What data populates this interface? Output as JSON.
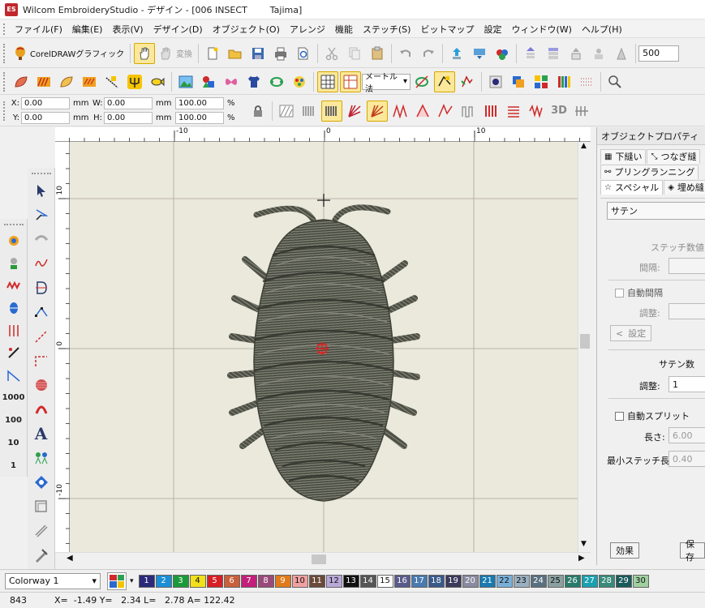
{
  "window": {
    "app_icon_text": "ES",
    "title": "Wilcom EmbroideryStudio - デザイン - [006 INSECT        Tajima]"
  },
  "menu": [
    "ファイル(F)",
    "編集(E)",
    "表示(V)",
    "デザイン(D)",
    "オブジェクト(O)",
    "アレンジ",
    "機能",
    "ステッチ(S)",
    "ビットマップ",
    "設定",
    "ウィンドウ(W)",
    "ヘルプ(H)"
  ],
  "toolbar1": {
    "coreldraw_label": "CorelDRAWグラフィック",
    "convert_label": "変換",
    "zoom_value": "500"
  },
  "toolbar2": {
    "unit_select": "メートル法"
  },
  "coords": {
    "x_label": "X:",
    "x_value": "0.00",
    "x_unit": "mm",
    "y_label": "Y:",
    "y_value": "0.00",
    "y_unit": "mm",
    "w_label": "W:",
    "w_value": "0.00",
    "w_unit": "mm",
    "h_label": "H:",
    "h_value": "0.00",
    "h_unit": "mm",
    "w_pct": "100.00",
    "h_pct": "100.00",
    "pct": "%"
  },
  "ruler": {
    "h_labels": [
      "-10",
      "0",
      "10"
    ],
    "v_labels": [
      "10",
      "0",
      "-10"
    ]
  },
  "left_tools": {
    "numbers": [
      "1000",
      "100",
      "10",
      "1"
    ]
  },
  "panel": {
    "title": "オブジェクトプロパティ",
    "tabs_row1": [
      "下縫い",
      "つなぎ縫"
    ],
    "tabs_row2": [
      "プリングランニング"
    ],
    "tabs_row3": [
      "スペシャル",
      "埋め縫"
    ],
    "stitch_type": "サテン",
    "stitch_values_heading": "ステッチ数値",
    "spacing_label": "間隔:",
    "auto_spacing_label": "自動間隔",
    "adjust_label_1": "調整:",
    "settings_label": "設定",
    "satin_count_heading": "サテン数",
    "adjust_label_2": "調整:",
    "adjust_value_2": "1",
    "auto_split_label": "自動スプリット",
    "length_label": "長さ:",
    "length_value": "6.00",
    "min_stitch_label": "最小ステッチ長:",
    "min_stitch_value": "0.40",
    "effect_button": "効果",
    "save_button": "保存"
  },
  "colorbar": {
    "colorway": "Colorway 1",
    "swatches": [
      {
        "n": "1",
        "bg": "#2b2b7a",
        "fg": "#ffffff"
      },
      {
        "n": "2",
        "bg": "#1a8fd6",
        "fg": "#ffffff"
      },
      {
        "n": "3",
        "bg": "#1c9a3b",
        "fg": "#ffffff"
      },
      {
        "n": "4",
        "bg": "#f2e01a",
        "fg": "#111111"
      },
      {
        "n": "5",
        "bg": "#d61f26",
        "fg": "#ffffff"
      },
      {
        "n": "6",
        "bg": "#c8603a",
        "fg": "#ffffff"
      },
      {
        "n": "7",
        "bg": "#c2207a",
        "fg": "#ffffff"
      },
      {
        "n": "8",
        "bg": "#9a4a7a",
        "fg": "#ffffff"
      },
      {
        "n": "9",
        "bg": "#e07a1a",
        "fg": "#ffffff"
      },
      {
        "n": "10",
        "bg": "#f0a0a0",
        "fg": "#111111"
      },
      {
        "n": "11",
        "bg": "#6a4a3a",
        "fg": "#ffffff"
      },
      {
        "n": "12",
        "bg": "#b8a8d8",
        "fg": "#111111"
      },
      {
        "n": "13",
        "bg": "#111111",
        "fg": "#ffffff"
      },
      {
        "n": "14",
        "bg": "#555555",
        "fg": "#ffffff"
      },
      {
        "n": "15",
        "bg": "#ffffff",
        "fg": "#111111"
      },
      {
        "n": "16",
        "bg": "#5a5a8a",
        "fg": "#ffffff"
      },
      {
        "n": "17",
        "bg": "#4a7ab0",
        "fg": "#ffffff"
      },
      {
        "n": "18",
        "bg": "#3a5a8a",
        "fg": "#ffffff"
      },
      {
        "n": "19",
        "bg": "#3a3a5a",
        "fg": "#ffffff"
      },
      {
        "n": "20",
        "bg": "#8a8aa0",
        "fg": "#ffffff"
      },
      {
        "n": "21",
        "bg": "#1a7ab0",
        "fg": "#ffffff"
      },
      {
        "n": "22",
        "bg": "#7ab0d8",
        "fg": "#111111"
      },
      {
        "n": "23",
        "bg": "#9ab0c0",
        "fg": "#111111"
      },
      {
        "n": "24",
        "bg": "#5a7080",
        "fg": "#ffffff"
      },
      {
        "n": "25",
        "bg": "#8aa0a0",
        "fg": "#111111"
      },
      {
        "n": "26",
        "bg": "#2a7a6a",
        "fg": "#ffffff"
      },
      {
        "n": "27",
        "bg": "#1aa0b0",
        "fg": "#ffffff"
      },
      {
        "n": "28",
        "bg": "#3a8a7a",
        "fg": "#ffffff"
      },
      {
        "n": "29",
        "bg": "#1a5a5a",
        "fg": "#ffffff"
      },
      {
        "n": "30",
        "bg": "#a0d0a0",
        "fg": "#111111"
      }
    ]
  },
  "status": {
    "stitch_count": "843",
    "readout": "X=  -1.49 Y=   2.34 L=   2.78 A= 122.42"
  }
}
